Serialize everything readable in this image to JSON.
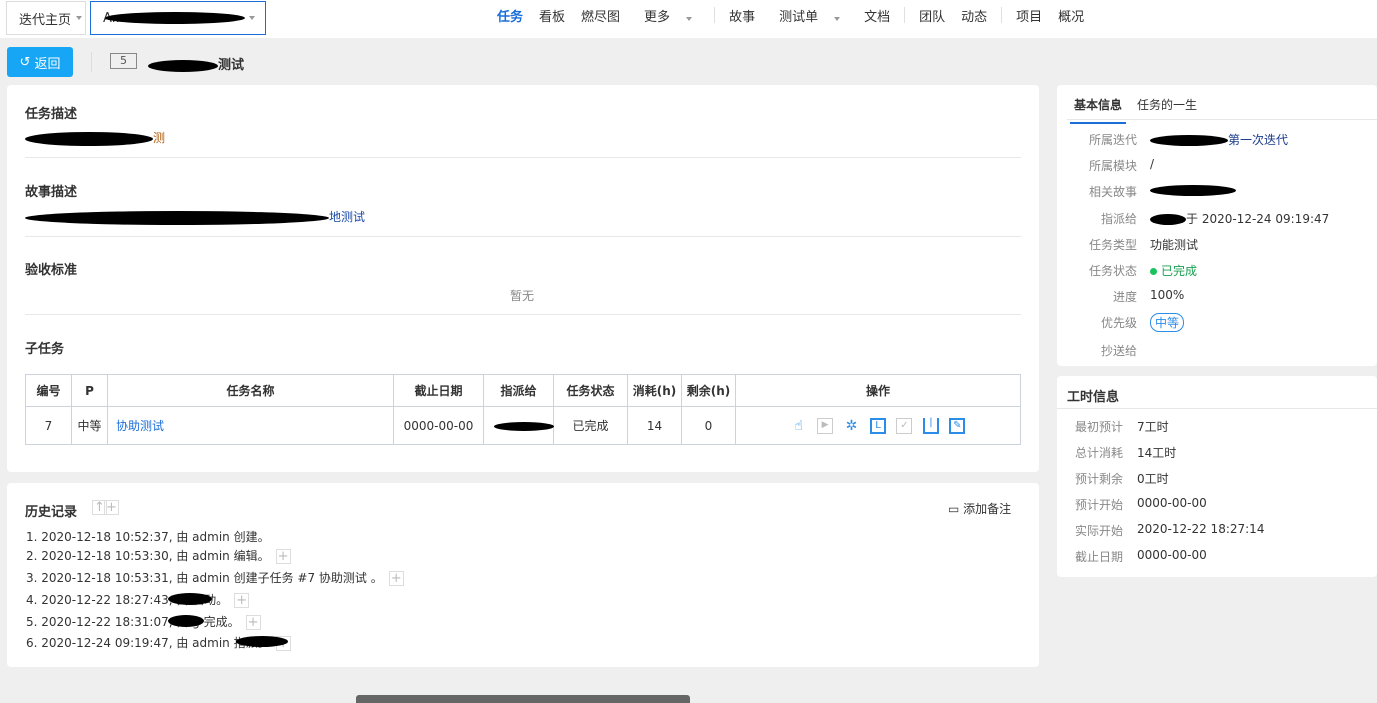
{
  "breadcrumb": {
    "home": "迭代主页",
    "current": "A..."
  },
  "nav": {
    "items": [
      "任务",
      "看板",
      "燃尽图",
      "更多",
      "故事",
      "测试单",
      "文档",
      "团队",
      "动态",
      "项目",
      "概况"
    ]
  },
  "header": {
    "back_label": "返回",
    "task_id": "5",
    "task_title_suffix": "测试"
  },
  "main": {
    "task_desc_title": "任务描述",
    "task_desc_suffix": "测",
    "story_desc_title": "故事描述",
    "story_desc_suffix": "地测试",
    "acceptance_title": "验收标准",
    "acceptance_value": "暂无",
    "subtasks_title": "子任务",
    "table": {
      "headers": [
        "编号",
        "P",
        "任务名称",
        "截止日期",
        "指派给",
        "任务状态",
        "消耗(h)",
        "剩余(h)",
        "操作"
      ],
      "rows": [
        {
          "id": "7",
          "priority": "中等",
          "name": "协助测试",
          "deadline": "0000-00-00",
          "assignee": "",
          "status": "已完成",
          "consumed": "14",
          "left": "0"
        }
      ]
    }
  },
  "history": {
    "title": "历史记录",
    "add_note": "添加备注",
    "entries": [
      "1. 2020-12-18 10:52:37, 由 admin 创建。",
      "2. 2020-12-18 10:53:30, 由 admin 编辑。",
      "3. 2020-12-18 10:53:31, 由 admin 创建子任务 #7 协助测试 。",
      "4. 2020-12-22 18:27:43, 由 启动。",
      "5. 2020-12-22 18:31:07, 由 g 完成。",
      "6. 2020-12-24 09:19:47, 由 admin 指派。"
    ]
  },
  "basic": {
    "tabs": [
      "基本信息",
      "任务的一生"
    ],
    "fields": [
      {
        "label": "所属迭代",
        "value": "第一次迭代"
      },
      {
        "label": "所属模块",
        "value": "/"
      },
      {
        "label": "相关故事",
        "value": ""
      },
      {
        "label": "指派给",
        "value": "于 2020-12-24 09:19:47"
      },
      {
        "label": "任务类型",
        "value": "功能测试"
      },
      {
        "label": "任务状态",
        "value": "已完成"
      },
      {
        "label": "进度",
        "value": "100%"
      },
      {
        "label": "优先级",
        "value": "中等"
      },
      {
        "label": "抄送给",
        "value": ""
      }
    ]
  },
  "worktime": {
    "title": "工时信息",
    "fields": [
      {
        "label": "最初预计",
        "value": "7工时"
      },
      {
        "label": "总计消耗",
        "value": "14工时"
      },
      {
        "label": "预计剩余",
        "value": "0工时"
      },
      {
        "label": "预计开始",
        "value": "0000-00-00"
      },
      {
        "label": "实际开始",
        "value": "2020-12-22 18:27:14"
      },
      {
        "label": "截止日期",
        "value": "0000-00-00"
      }
    ]
  },
  "colors": {
    "accent": "#1a6ed8",
    "back_button": "#16a6f5",
    "done": "#18c25c"
  }
}
